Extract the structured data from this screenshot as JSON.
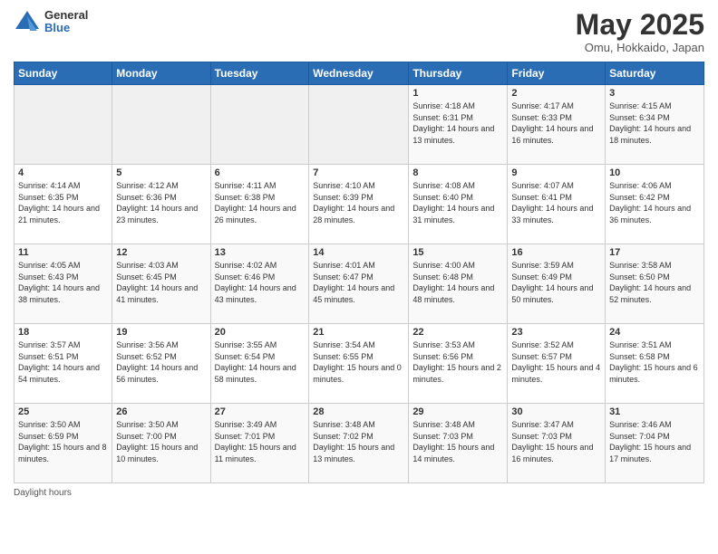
{
  "header": {
    "logo_general": "General",
    "logo_blue": "Blue",
    "title": "May 2025",
    "location": "Omu, Hokkaido, Japan"
  },
  "weekdays": [
    "Sunday",
    "Monday",
    "Tuesday",
    "Wednesday",
    "Thursday",
    "Friday",
    "Saturday"
  ],
  "weeks": [
    [
      {
        "day": "",
        "sunrise": "",
        "sunset": "",
        "daylight": "",
        "empty": true
      },
      {
        "day": "",
        "sunrise": "",
        "sunset": "",
        "daylight": "",
        "empty": true
      },
      {
        "day": "",
        "sunrise": "",
        "sunset": "",
        "daylight": "",
        "empty": true
      },
      {
        "day": "",
        "sunrise": "",
        "sunset": "",
        "daylight": "",
        "empty": true
      },
      {
        "day": "1",
        "sunrise": "4:18 AM",
        "sunset": "6:31 PM",
        "daylight": "14 hours and 13 minutes."
      },
      {
        "day": "2",
        "sunrise": "4:17 AM",
        "sunset": "6:33 PM",
        "daylight": "14 hours and 16 minutes."
      },
      {
        "day": "3",
        "sunrise": "4:15 AM",
        "sunset": "6:34 PM",
        "daylight": "14 hours and 18 minutes."
      }
    ],
    [
      {
        "day": "4",
        "sunrise": "4:14 AM",
        "sunset": "6:35 PM",
        "daylight": "14 hours and 21 minutes."
      },
      {
        "day": "5",
        "sunrise": "4:12 AM",
        "sunset": "6:36 PM",
        "daylight": "14 hours and 23 minutes."
      },
      {
        "day": "6",
        "sunrise": "4:11 AM",
        "sunset": "6:38 PM",
        "daylight": "14 hours and 26 minutes."
      },
      {
        "day": "7",
        "sunrise": "4:10 AM",
        "sunset": "6:39 PM",
        "daylight": "14 hours and 28 minutes."
      },
      {
        "day": "8",
        "sunrise": "4:08 AM",
        "sunset": "6:40 PM",
        "daylight": "14 hours and 31 minutes."
      },
      {
        "day": "9",
        "sunrise": "4:07 AM",
        "sunset": "6:41 PM",
        "daylight": "14 hours and 33 minutes."
      },
      {
        "day": "10",
        "sunrise": "4:06 AM",
        "sunset": "6:42 PM",
        "daylight": "14 hours and 36 minutes."
      }
    ],
    [
      {
        "day": "11",
        "sunrise": "4:05 AM",
        "sunset": "6:43 PM",
        "daylight": "14 hours and 38 minutes."
      },
      {
        "day": "12",
        "sunrise": "4:03 AM",
        "sunset": "6:45 PM",
        "daylight": "14 hours and 41 minutes."
      },
      {
        "day": "13",
        "sunrise": "4:02 AM",
        "sunset": "6:46 PM",
        "daylight": "14 hours and 43 minutes."
      },
      {
        "day": "14",
        "sunrise": "4:01 AM",
        "sunset": "6:47 PM",
        "daylight": "14 hours and 45 minutes."
      },
      {
        "day": "15",
        "sunrise": "4:00 AM",
        "sunset": "6:48 PM",
        "daylight": "14 hours and 48 minutes."
      },
      {
        "day": "16",
        "sunrise": "3:59 AM",
        "sunset": "6:49 PM",
        "daylight": "14 hours and 50 minutes."
      },
      {
        "day": "17",
        "sunrise": "3:58 AM",
        "sunset": "6:50 PM",
        "daylight": "14 hours and 52 minutes."
      }
    ],
    [
      {
        "day": "18",
        "sunrise": "3:57 AM",
        "sunset": "6:51 PM",
        "daylight": "14 hours and 54 minutes."
      },
      {
        "day": "19",
        "sunrise": "3:56 AM",
        "sunset": "6:52 PM",
        "daylight": "14 hours and 56 minutes."
      },
      {
        "day": "20",
        "sunrise": "3:55 AM",
        "sunset": "6:54 PM",
        "daylight": "14 hours and 58 minutes."
      },
      {
        "day": "21",
        "sunrise": "3:54 AM",
        "sunset": "6:55 PM",
        "daylight": "15 hours and 0 minutes."
      },
      {
        "day": "22",
        "sunrise": "3:53 AM",
        "sunset": "6:56 PM",
        "daylight": "15 hours and 2 minutes."
      },
      {
        "day": "23",
        "sunrise": "3:52 AM",
        "sunset": "6:57 PM",
        "daylight": "15 hours and 4 minutes."
      },
      {
        "day": "24",
        "sunrise": "3:51 AM",
        "sunset": "6:58 PM",
        "daylight": "15 hours and 6 minutes."
      }
    ],
    [
      {
        "day": "25",
        "sunrise": "3:50 AM",
        "sunset": "6:59 PM",
        "daylight": "15 hours and 8 minutes."
      },
      {
        "day": "26",
        "sunrise": "3:50 AM",
        "sunset": "7:00 PM",
        "daylight": "15 hours and 10 minutes."
      },
      {
        "day": "27",
        "sunrise": "3:49 AM",
        "sunset": "7:01 PM",
        "daylight": "15 hours and 11 minutes."
      },
      {
        "day": "28",
        "sunrise": "3:48 AM",
        "sunset": "7:02 PM",
        "daylight": "15 hours and 13 minutes."
      },
      {
        "day": "29",
        "sunrise": "3:48 AM",
        "sunset": "7:03 PM",
        "daylight": "15 hours and 14 minutes."
      },
      {
        "day": "30",
        "sunrise": "3:47 AM",
        "sunset": "7:03 PM",
        "daylight": "15 hours and 16 minutes."
      },
      {
        "day": "31",
        "sunrise": "3:46 AM",
        "sunset": "7:04 PM",
        "daylight": "15 hours and 17 minutes."
      }
    ]
  ],
  "footer": {
    "daylight_label": "Daylight hours"
  }
}
